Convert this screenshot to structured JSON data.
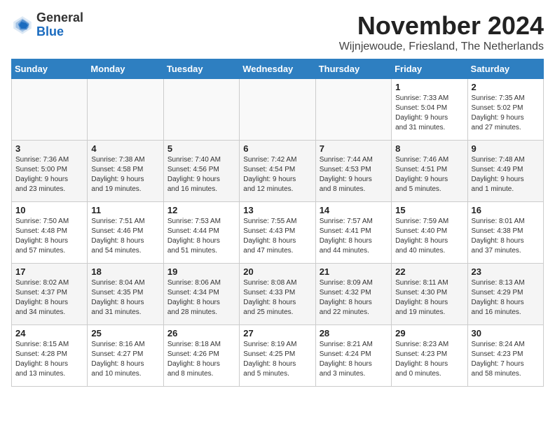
{
  "header": {
    "logo_general": "General",
    "logo_blue": "Blue",
    "month_title": "November 2024",
    "location": "Wijnjewoude, Friesland, The Netherlands"
  },
  "calendar": {
    "weekdays": [
      "Sunday",
      "Monday",
      "Tuesday",
      "Wednesday",
      "Thursday",
      "Friday",
      "Saturday"
    ],
    "weeks": [
      [
        {
          "day": "",
          "info": ""
        },
        {
          "day": "",
          "info": ""
        },
        {
          "day": "",
          "info": ""
        },
        {
          "day": "",
          "info": ""
        },
        {
          "day": "",
          "info": ""
        },
        {
          "day": "1",
          "info": "Sunrise: 7:33 AM\nSunset: 5:04 PM\nDaylight: 9 hours\nand 31 minutes."
        },
        {
          "day": "2",
          "info": "Sunrise: 7:35 AM\nSunset: 5:02 PM\nDaylight: 9 hours\nand 27 minutes."
        }
      ],
      [
        {
          "day": "3",
          "info": "Sunrise: 7:36 AM\nSunset: 5:00 PM\nDaylight: 9 hours\nand 23 minutes."
        },
        {
          "day": "4",
          "info": "Sunrise: 7:38 AM\nSunset: 4:58 PM\nDaylight: 9 hours\nand 19 minutes."
        },
        {
          "day": "5",
          "info": "Sunrise: 7:40 AM\nSunset: 4:56 PM\nDaylight: 9 hours\nand 16 minutes."
        },
        {
          "day": "6",
          "info": "Sunrise: 7:42 AM\nSunset: 4:54 PM\nDaylight: 9 hours\nand 12 minutes."
        },
        {
          "day": "7",
          "info": "Sunrise: 7:44 AM\nSunset: 4:53 PM\nDaylight: 9 hours\nand 8 minutes."
        },
        {
          "day": "8",
          "info": "Sunrise: 7:46 AM\nSunset: 4:51 PM\nDaylight: 9 hours\nand 5 minutes."
        },
        {
          "day": "9",
          "info": "Sunrise: 7:48 AM\nSunset: 4:49 PM\nDaylight: 9 hours\nand 1 minute."
        }
      ],
      [
        {
          "day": "10",
          "info": "Sunrise: 7:50 AM\nSunset: 4:48 PM\nDaylight: 8 hours\nand 57 minutes."
        },
        {
          "day": "11",
          "info": "Sunrise: 7:51 AM\nSunset: 4:46 PM\nDaylight: 8 hours\nand 54 minutes."
        },
        {
          "day": "12",
          "info": "Sunrise: 7:53 AM\nSunset: 4:44 PM\nDaylight: 8 hours\nand 51 minutes."
        },
        {
          "day": "13",
          "info": "Sunrise: 7:55 AM\nSunset: 4:43 PM\nDaylight: 8 hours\nand 47 minutes."
        },
        {
          "day": "14",
          "info": "Sunrise: 7:57 AM\nSunset: 4:41 PM\nDaylight: 8 hours\nand 44 minutes."
        },
        {
          "day": "15",
          "info": "Sunrise: 7:59 AM\nSunset: 4:40 PM\nDaylight: 8 hours\nand 40 minutes."
        },
        {
          "day": "16",
          "info": "Sunrise: 8:01 AM\nSunset: 4:38 PM\nDaylight: 8 hours\nand 37 minutes."
        }
      ],
      [
        {
          "day": "17",
          "info": "Sunrise: 8:02 AM\nSunset: 4:37 PM\nDaylight: 8 hours\nand 34 minutes."
        },
        {
          "day": "18",
          "info": "Sunrise: 8:04 AM\nSunset: 4:35 PM\nDaylight: 8 hours\nand 31 minutes."
        },
        {
          "day": "19",
          "info": "Sunrise: 8:06 AM\nSunset: 4:34 PM\nDaylight: 8 hours\nand 28 minutes."
        },
        {
          "day": "20",
          "info": "Sunrise: 8:08 AM\nSunset: 4:33 PM\nDaylight: 8 hours\nand 25 minutes."
        },
        {
          "day": "21",
          "info": "Sunrise: 8:09 AM\nSunset: 4:32 PM\nDaylight: 8 hours\nand 22 minutes."
        },
        {
          "day": "22",
          "info": "Sunrise: 8:11 AM\nSunset: 4:30 PM\nDaylight: 8 hours\nand 19 minutes."
        },
        {
          "day": "23",
          "info": "Sunrise: 8:13 AM\nSunset: 4:29 PM\nDaylight: 8 hours\nand 16 minutes."
        }
      ],
      [
        {
          "day": "24",
          "info": "Sunrise: 8:15 AM\nSunset: 4:28 PM\nDaylight: 8 hours\nand 13 minutes."
        },
        {
          "day": "25",
          "info": "Sunrise: 8:16 AM\nSunset: 4:27 PM\nDaylight: 8 hours\nand 10 minutes."
        },
        {
          "day": "26",
          "info": "Sunrise: 8:18 AM\nSunset: 4:26 PM\nDaylight: 8 hours\nand 8 minutes."
        },
        {
          "day": "27",
          "info": "Sunrise: 8:19 AM\nSunset: 4:25 PM\nDaylight: 8 hours\nand 5 minutes."
        },
        {
          "day": "28",
          "info": "Sunrise: 8:21 AM\nSunset: 4:24 PM\nDaylight: 8 hours\nand 3 minutes."
        },
        {
          "day": "29",
          "info": "Sunrise: 8:23 AM\nSunset: 4:23 PM\nDaylight: 8 hours\nand 0 minutes."
        },
        {
          "day": "30",
          "info": "Sunrise: 8:24 AM\nSunset: 4:23 PM\nDaylight: 7 hours\nand 58 minutes."
        }
      ]
    ]
  }
}
